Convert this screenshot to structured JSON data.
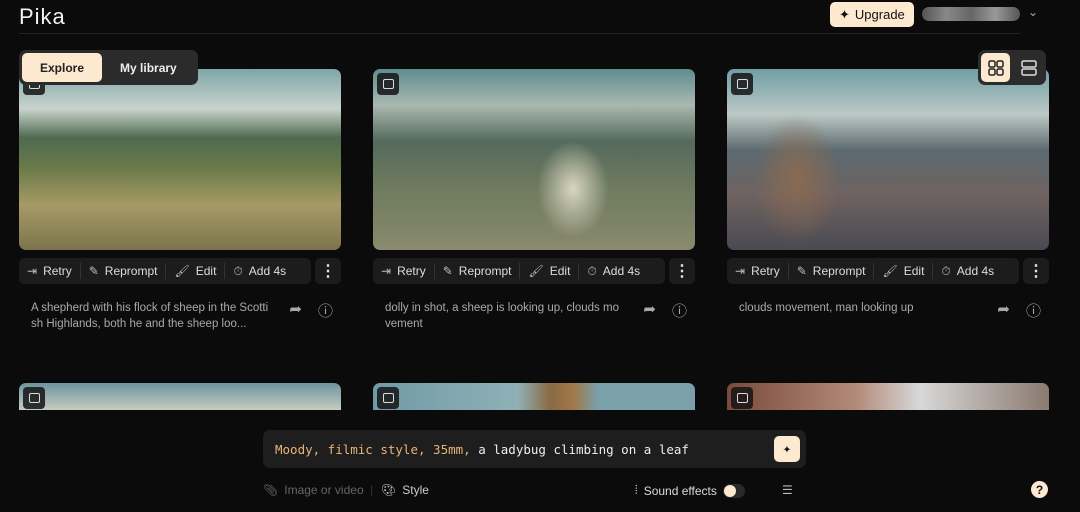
{
  "header": {
    "logo": "Pika",
    "upgrade_label": "Upgrade"
  },
  "tabs": [
    {
      "label": "Explore",
      "active": true
    },
    {
      "label": "My library",
      "active": false
    }
  ],
  "view_toggle": {
    "active": "grid"
  },
  "actions": {
    "retry": "Retry",
    "reprompt": "Reprompt",
    "edit": "Edit",
    "add": "Add 4s"
  },
  "cards": [
    {
      "caption": "A shepherd with his flock of sheep in the Scottish Highlands, both he and the sheep loo..."
    },
    {
      "caption": "dolly in shot, a sheep is looking up, clouds movement"
    },
    {
      "caption": "clouds movement, man looking up"
    }
  ],
  "prompt": {
    "style_part": "Moody, filmic style, 35mm,",
    "subject_part": " a ladybug climbing on a leaf"
  },
  "toolbar": {
    "attach": "Image or video",
    "style": "Style",
    "sound_effects": "Sound effects",
    "sound_on": false
  },
  "help": "?",
  "colors": {
    "accent": "#fce9cf",
    "prompt_highlight": "#e9b477",
    "background": "#0b0b0b"
  }
}
